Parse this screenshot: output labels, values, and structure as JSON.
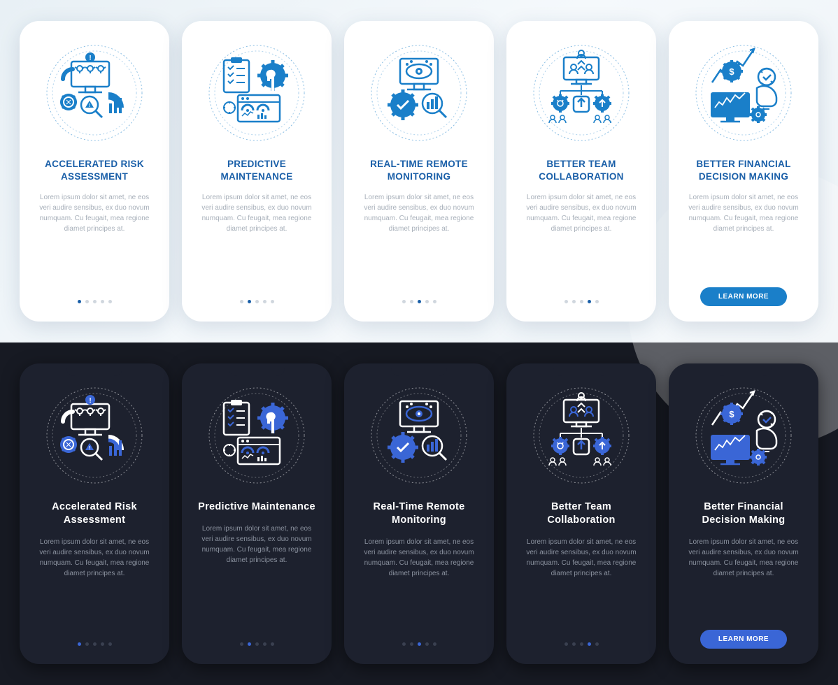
{
  "lorem": "Lorem ipsum dolor sit amet, ne eos veri audire sensibus, ex duo novum numquam. Cu feugait, mea regione diamet principes at.",
  "button_label": "LEARN MORE",
  "colors": {
    "light_accent": "#1a7fc9",
    "light_title": "#1a5fa8",
    "dark_bg": "#171a23",
    "dark_card": "#1d212e",
    "dark_accent": "#3a66d6"
  },
  "cards": [
    {
      "title_light": "ACCELERATED RISK ASSESSMENT",
      "title_dark": "Accelerated Risk Assessment",
      "active": 0,
      "icon": "risk"
    },
    {
      "title_light": "PREDICTIVE MAINTENANCE",
      "title_dark": "Predictive Maintenance",
      "active": 1,
      "icon": "maintenance"
    },
    {
      "title_light": "REAL-TIME REMOTE MONITORING",
      "title_dark": "Real-Time Remote Monitoring",
      "active": 2,
      "icon": "monitoring"
    },
    {
      "title_light": "BETTER TEAM COLLABORATION",
      "title_dark": "Better Team Collaboration",
      "active": 3,
      "icon": "team"
    },
    {
      "title_light": "BETTER FINANCIAL DECISION MAKING",
      "title_dark": "Better Financial Decision Making",
      "active": 4,
      "icon": "finance"
    }
  ]
}
